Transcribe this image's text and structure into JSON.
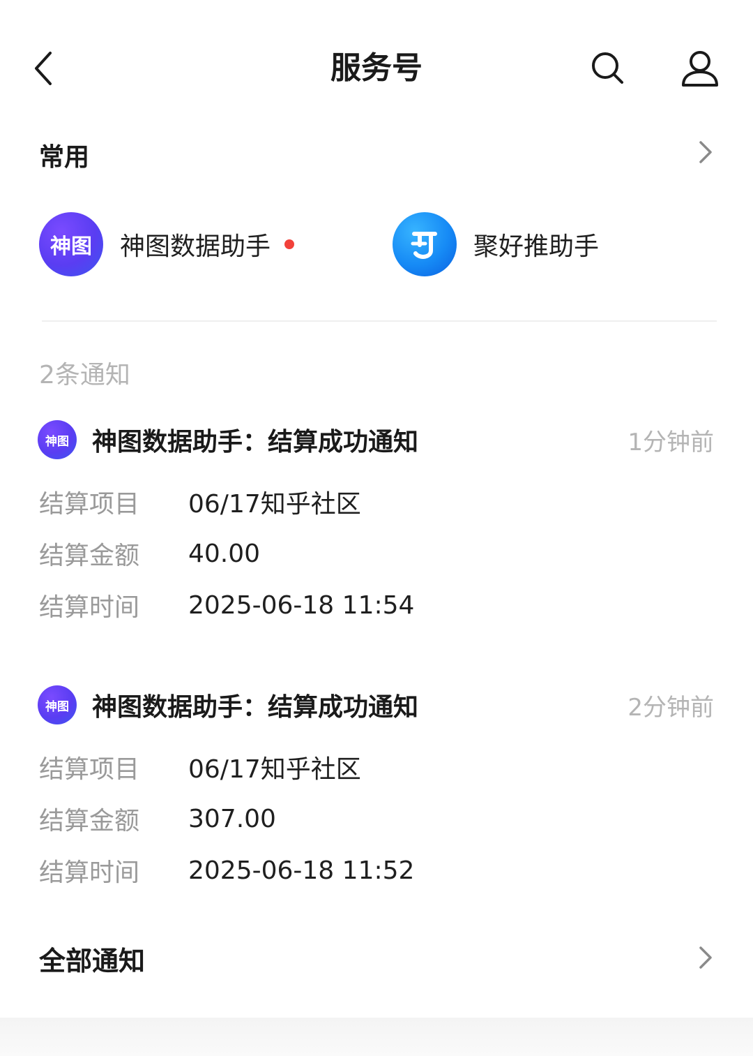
{
  "header": {
    "title": "服务号",
    "back_icon": "chevron-left-icon",
    "search_icon": "search-icon",
    "profile_icon": "user-icon"
  },
  "favorites": {
    "title": "常用",
    "items": [
      {
        "name": "神图数据助手",
        "logo_text": "神图",
        "unread": true,
        "color_from": "#6a38f0",
        "color_to": "#3d5cf5"
      },
      {
        "name": "聚好推助手",
        "logo_text": "TJ",
        "unread": false,
        "color_from": "#1aa3ff",
        "color_to": "#0a63e6"
      }
    ]
  },
  "notifications": {
    "count_label": "2条通知",
    "items": [
      {
        "sender_logo": "神图",
        "title": "神图数据助手：结算成功通知",
        "time": "1分钟前",
        "rows": [
          {
            "label": "结算项目",
            "value": "06/17知乎社区"
          },
          {
            "label": "结算金额",
            "value": "40.00"
          },
          {
            "label": "结算时间",
            "value": "2025-06-18 11:54"
          }
        ]
      },
      {
        "sender_logo": "神图",
        "title": "神图数据助手：结算成功通知",
        "time": "2分钟前",
        "rows": [
          {
            "label": "结算项目",
            "value": "06/17知乎社区"
          },
          {
            "label": "结算金额",
            "value": "307.00"
          },
          {
            "label": "结算时间",
            "value": "2025-06-18 11:52"
          }
        ]
      }
    ]
  },
  "footer": {
    "all_label": "全部通知"
  },
  "colors": {
    "unread_dot": "#f2413a",
    "muted_text": "#b4b4b4",
    "label_text": "#9a9a9a"
  }
}
